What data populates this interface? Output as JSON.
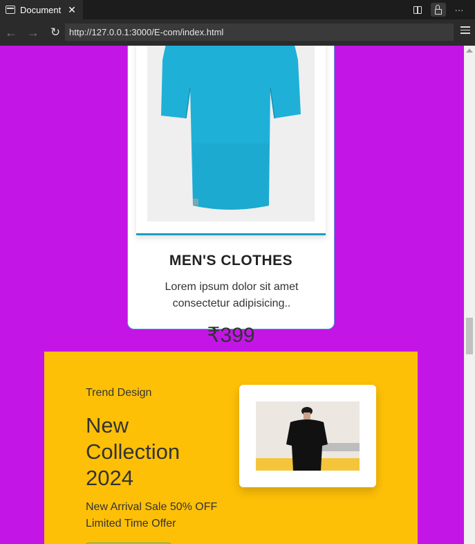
{
  "browser": {
    "tab_title": "Document",
    "tab_close": "✕",
    "url": "http://127.0.0.1:3000/E-com/index.html"
  },
  "product": {
    "title": "MEN'S CLOTHES",
    "description": "Lorem ipsum dolor sit amet consectetur adipisicing..",
    "price": "₹399",
    "image_icon": "tshirt-image"
  },
  "banner": {
    "eyebrow": "Trend Design",
    "heading": "New Collection 2024",
    "sale_line": "New Arrival Sale 50% OFF Limited Time Offer",
    "image_icon": "model-photo"
  },
  "colors": {
    "page_background": "#c316e6",
    "banner_background": "#fec007",
    "tshirt": "#1fb0d8",
    "card_accent": "#1f9cbf"
  }
}
